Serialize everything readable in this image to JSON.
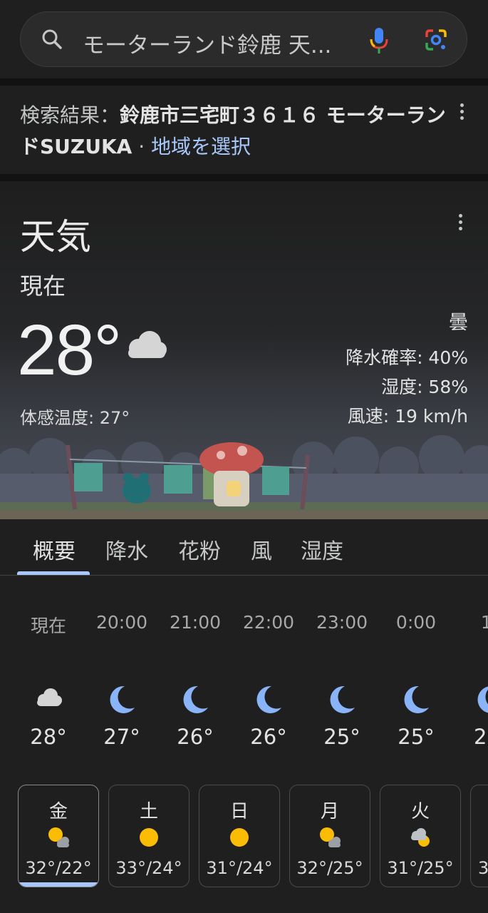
{
  "search": {
    "query": "モーターランド鈴鹿 天..."
  },
  "location": {
    "prefix": "検索結果：",
    "place": "鈴鹿市三宅町３６１６ モーターランドSUZUKA",
    "dot": " · ",
    "link": "地域を選択"
  },
  "weather": {
    "title": "天気",
    "now_label": "現在",
    "temperature": "28°",
    "feels_like": "体感温度: 27°",
    "condition": "曇",
    "precip": "降水確率: 40%",
    "humidity": "湿度: 58%",
    "wind": "風速: 19 km/h"
  },
  "tabs": [
    {
      "label": "概要",
      "active": true
    },
    {
      "label": "降水"
    },
    {
      "label": "花粉"
    },
    {
      "label": "風"
    },
    {
      "label": "湿度"
    }
  ],
  "hourly": [
    {
      "time": "現在",
      "icon": "cloud-icon",
      "temp": "28°"
    },
    {
      "time": "20:00",
      "icon": "moon-icon",
      "temp": "27°"
    },
    {
      "time": "21:00",
      "icon": "moon-icon",
      "temp": "26°"
    },
    {
      "time": "22:00",
      "icon": "moon-icon",
      "temp": "26°"
    },
    {
      "time": "23:00",
      "icon": "moon-icon",
      "temp": "25°"
    },
    {
      "time": "0:00",
      "icon": "moon-icon",
      "temp": "25°"
    },
    {
      "time": "1:",
      "icon": "moon-icon",
      "temp": "2"
    }
  ],
  "daily": [
    {
      "day": "金",
      "icon": "sun-cloud-icon",
      "temps": "32°/22°",
      "selected": true
    },
    {
      "day": "土",
      "icon": "sun-icon",
      "temps": "33°/24°"
    },
    {
      "day": "日",
      "icon": "sun-icon",
      "temps": "31°/24°"
    },
    {
      "day": "月",
      "icon": "sun-cloud-icon",
      "temps": "32°/25°"
    },
    {
      "day": "火",
      "icon": "cloud-sun-icon",
      "temps": "31°/25°"
    },
    {
      "day": "",
      "icon": "",
      "temps": "3"
    }
  ]
}
